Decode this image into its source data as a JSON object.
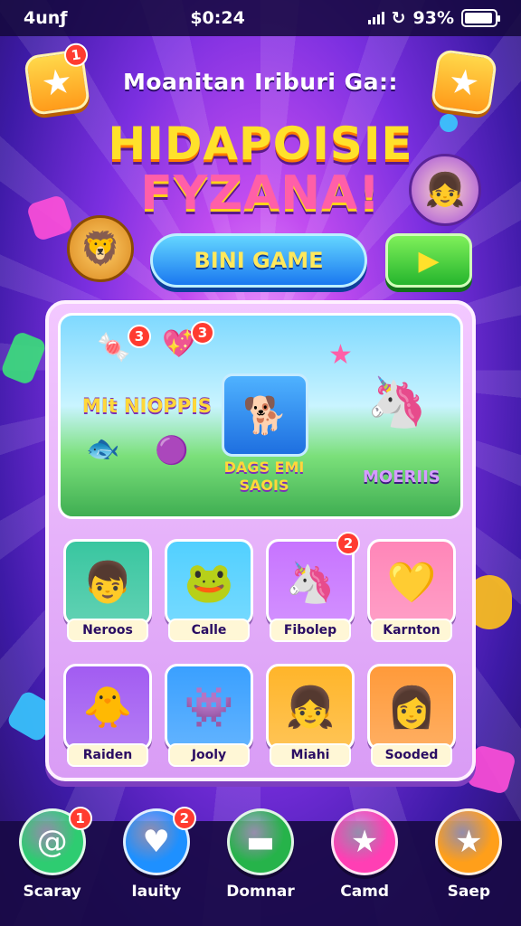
{
  "status_bar": {
    "carrier": "4unƒ",
    "time": "$0:24",
    "battery_text": "93%",
    "battery_level": 0.93
  },
  "header": {
    "title": "Moanitan Iriburi Ga::",
    "left_badge": "1"
  },
  "logo": {
    "line1": "HIDAPOISIE",
    "line2": "FYZANA!"
  },
  "actions": {
    "mini_game": "BINI GAME"
  },
  "banner": {
    "left_label": "MIt NIOPPIS",
    "center_label_1": "DAGS EMI",
    "center_label_2": "SAOIS",
    "right_label": "MOERIIS",
    "badge_a": "3",
    "badge_b": "3"
  },
  "tiles": [
    {
      "label": "Neroos",
      "icon": "boy-icon",
      "glyph": "👦",
      "bg": "#39c6a0"
    },
    {
      "label": "Calle",
      "icon": "green-bear-icon",
      "glyph": "🐸",
      "bg": "#52d0ff"
    },
    {
      "label": "Fibolep",
      "icon": "unicorn-icon",
      "glyph": "🦄",
      "bg": "#c774ff",
      "badge": "2"
    },
    {
      "label": "Karnton",
      "icon": "heart-fruit-icon",
      "glyph": "💛",
      "bg": "#ff86b8"
    },
    {
      "label": "Raiden",
      "icon": "yellow-creature-icon",
      "glyph": "🐥",
      "bg": "#a25cf2"
    },
    {
      "label": "Jooly",
      "icon": "green-creature-icon",
      "glyph": "👾",
      "bg": "#3aa0ff"
    },
    {
      "label": "Miahi",
      "icon": "girl-icon",
      "glyph": "👧",
      "bg": "#ffb52a"
    },
    {
      "label": "Sooded",
      "icon": "purple-girl-icon",
      "glyph": "👩",
      "bg": "#ff9a3a"
    }
  ],
  "bottom_nav": [
    {
      "label": "Scaray",
      "icon": "at-icon",
      "glyph": "@",
      "bg": "#2ecc71",
      "badge": "1"
    },
    {
      "label": "Iauity",
      "icon": "heart-icon",
      "glyph": "♥",
      "bg": "#1e90ff",
      "badge": "2"
    },
    {
      "label": "Domnar",
      "icon": "ticket-icon",
      "glyph": "▬",
      "bg": "#26b34a"
    },
    {
      "label": "Camd",
      "icon": "star-icon",
      "glyph": "★",
      "bg": "#ff3fb4"
    },
    {
      "label": "Saep",
      "icon": "star-shop-icon",
      "glyph": "★",
      "bg": "#ff9f1a"
    }
  ],
  "colors": {
    "accent_yellow": "#ffe12b",
    "accent_blue": "#1a78f0",
    "accent_green": "#25b52d",
    "badge_red": "#ff3b30"
  }
}
